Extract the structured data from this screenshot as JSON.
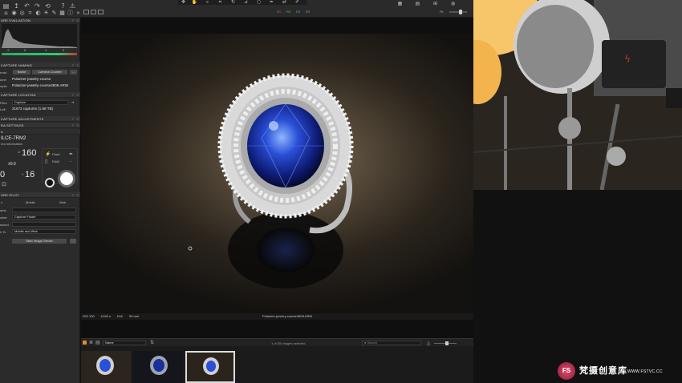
{
  "toolbar": {
    "color_tags": [
      "R1",
      "R2",
      "R3",
      "R3"
    ],
    "zoom_label": "Fit"
  },
  "left_panel": {
    "exposure_section": "URE EVALUATION",
    "histogram_ticks": [
      "-2",
      "0",
      "1",
      "2"
    ],
    "capture_naming_section": "CAPTURE NAMING",
    "format_label": "rmat",
    "format_tokens": [
      "Name",
      "Camera Counter"
    ],
    "name_label": "ame",
    "name_value": "Polarizer-jewelry-course",
    "sample_label": "mple",
    "sample_value": "Polarizer-jewelry-course3808.ARW",
    "capture_location_section": "CAPTURE LOCATION",
    "files_label": "Files",
    "files_value": "Capture",
    "left_label": "Left",
    "left_value": "21673 captures (1.69 TB)",
    "capture_adjustments_section": "CAPTURE ADJUSTMENTS",
    "camera_settings_section": "RA SETTINGS",
    "camera_model": "ILCE-7RM2",
    "camera_info": "era Information",
    "shutter": "160",
    "shutter_prefix": "1/",
    "exposure_comp": "±0.0",
    "aperture": "16",
    "aperture_prefix": "f",
    "iso_partial": "0",
    "flash_label": "Flash",
    "raw_label": "RAW",
    "capture_pilot_section": "URE PILOT",
    "pilot_tabs": [
      "e",
      "Mobile",
      "Web"
    ],
    "pilot_name_label": "ame",
    "pilot_folder_label": "older",
    "pilot_folder_value": "Capture Folder",
    "pilot_password_label": "sword",
    "pilot_device_label": "h To",
    "pilot_device_value": "Mobile and Web",
    "start_server_label": "Start Image Server"
  },
  "viewer": {
    "info": {
      "iso": "ISO 100",
      "shutter": "1/160 s",
      "aperture": "f/16",
      "focal": "90 mm",
      "filename": "Polarizer-jewelry-course3808.ARW"
    }
  },
  "browser": {
    "sort_value": "Name",
    "count_text": "1 of 35 Images selected",
    "search_placeholder": "Search"
  },
  "watermark": {
    "logo_text": "FS",
    "site_name": "梵摄创意库",
    "site_url": "WWW.FSTVC.CC"
  }
}
